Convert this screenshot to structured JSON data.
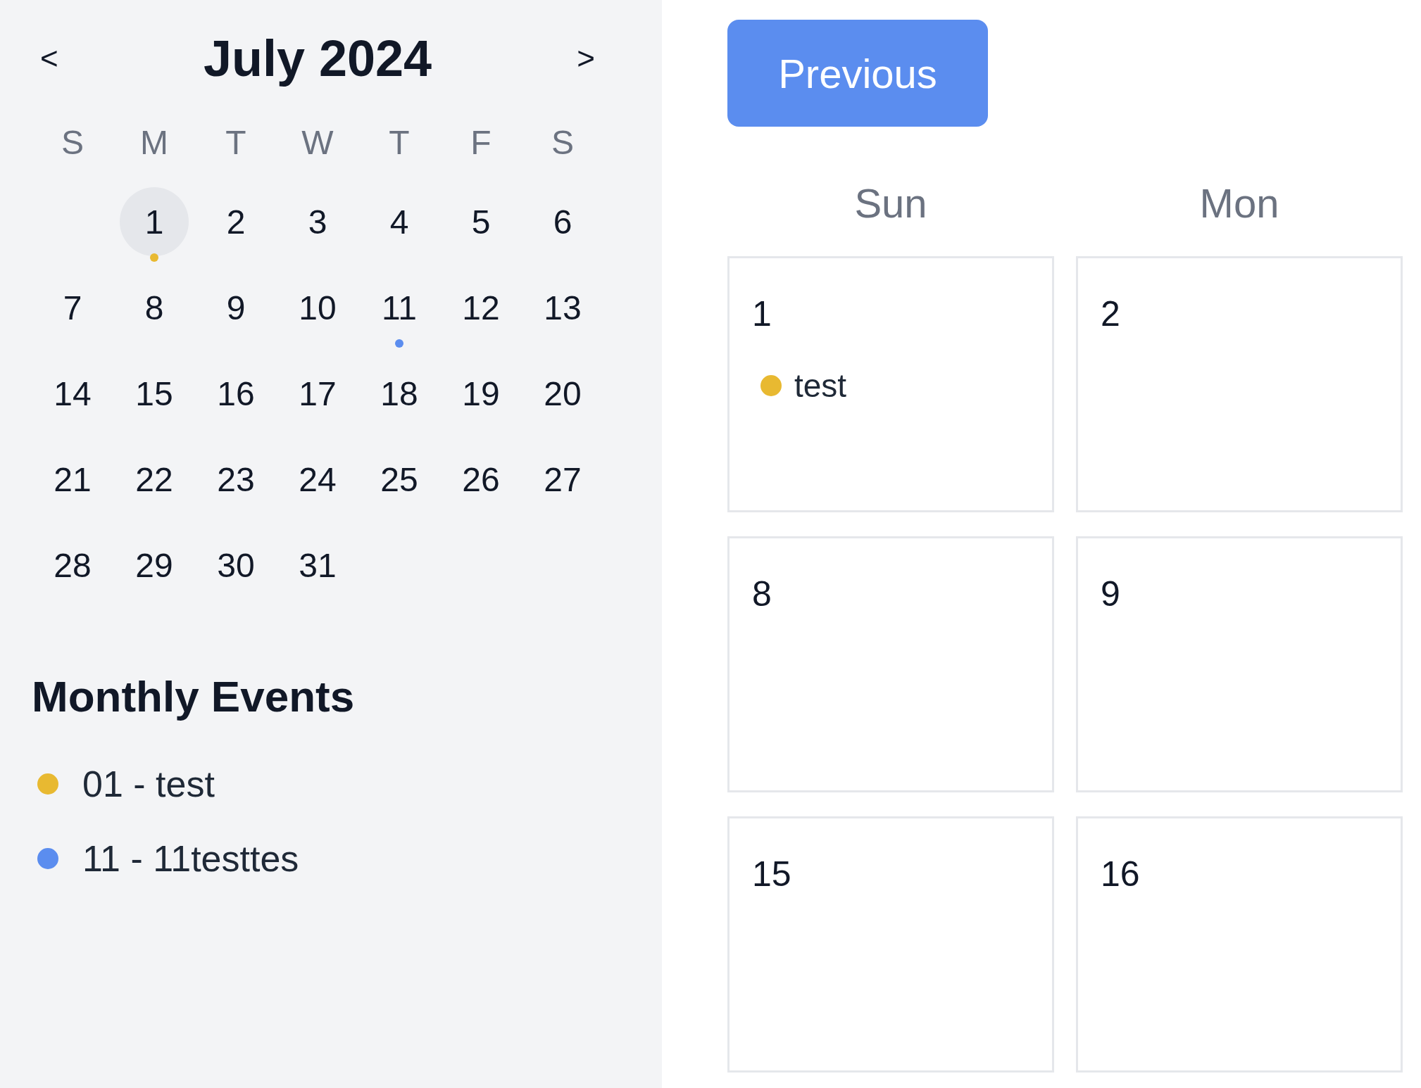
{
  "mini_calendar": {
    "prev": "<",
    "title": "July 2024",
    "next": ">",
    "weekdays": [
      "S",
      "M",
      "T",
      "W",
      "T",
      "F",
      "S"
    ],
    "days": [
      {
        "kind": "blank"
      },
      {
        "label": "1",
        "selected": true,
        "color": "#e8b931"
      },
      {
        "label": "2",
        "selected": false
      },
      {
        "label": "3",
        "selected": false
      },
      {
        "label": "4",
        "selected": false
      },
      {
        "label": "5",
        "selected": false
      },
      {
        "label": "6",
        "selected": false
      },
      {
        "label": "7",
        "selected": false
      },
      {
        "label": "8",
        "selected": false
      },
      {
        "label": "9",
        "selected": false
      },
      {
        "label": "10",
        "selected": false
      },
      {
        "label": "11",
        "selected": false,
        "color": "#5b8def"
      },
      {
        "label": "12",
        "selected": false
      },
      {
        "label": "13",
        "selected": false
      },
      {
        "label": "14",
        "selected": false
      },
      {
        "label": "15",
        "selected": false
      },
      {
        "label": "16",
        "selected": false
      },
      {
        "label": "17",
        "selected": false
      },
      {
        "label": "18",
        "selected": false
      },
      {
        "label": "19",
        "selected": false
      },
      {
        "label": "20",
        "selected": false
      },
      {
        "label": "21",
        "selected": false
      },
      {
        "label": "22",
        "selected": false
      },
      {
        "label": "23",
        "selected": false
      },
      {
        "label": "24",
        "selected": false
      },
      {
        "label": "25",
        "selected": false
      },
      {
        "label": "26",
        "selected": false
      },
      {
        "label": "27",
        "selected": false
      },
      {
        "label": "28",
        "selected": false
      },
      {
        "label": "29",
        "selected": false
      },
      {
        "label": "30",
        "selected": false
      },
      {
        "label": "31",
        "selected": false
      }
    ]
  },
  "monthly_events": {
    "title": "Monthly Events",
    "items": [
      {
        "label": "01 - test",
        "color": "#e8b931"
      },
      {
        "label": "11 - 11testtes",
        "color": "#5b8def"
      }
    ]
  },
  "week_view": {
    "button": "Previous",
    "columns": [
      "Sun",
      "Mon"
    ],
    "cells": [
      {
        "label": "1",
        "events": [
          {
            "label": "test",
            "color": "#e8b931"
          }
        ]
      },
      {
        "label": "2"
      },
      {
        "label": "8"
      },
      {
        "label": "9"
      },
      {
        "label": "15"
      },
      {
        "label": "16"
      }
    ]
  }
}
